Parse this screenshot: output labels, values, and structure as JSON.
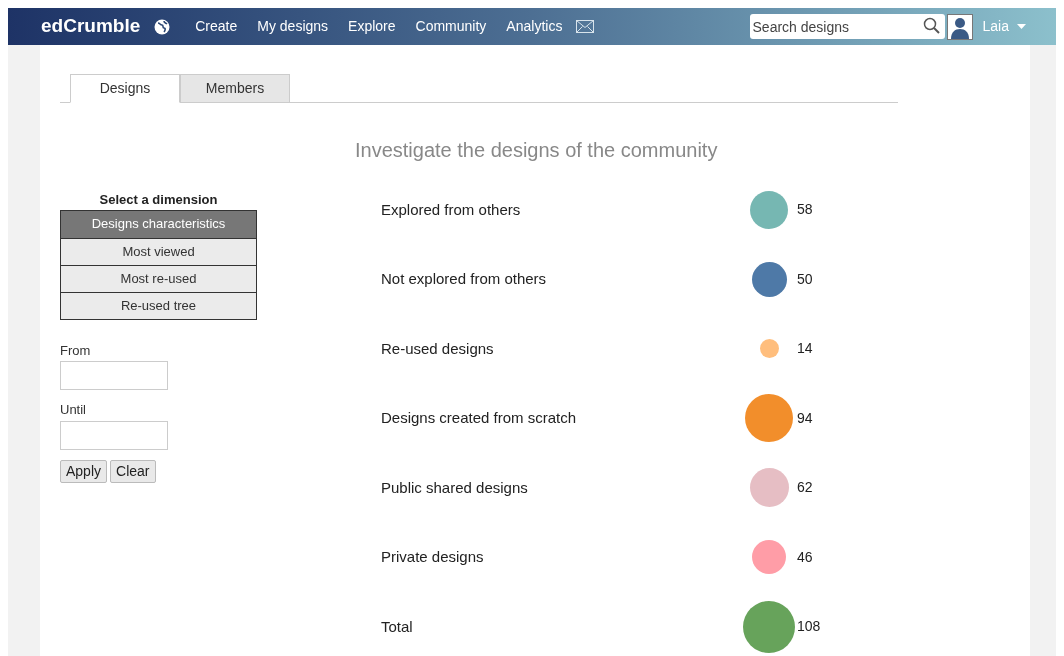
{
  "navbar": {
    "brand": "edCrumble",
    "links": [
      "Create",
      "My designs",
      "Explore",
      "Community",
      "Analytics"
    ],
    "search": {
      "placeholder": "Search designs"
    },
    "user": "Laia"
  },
  "tabs": [
    {
      "label": "Designs",
      "selected": true
    },
    {
      "label": "Members",
      "selected": false
    }
  ],
  "heading": "Investigate the designs of the community",
  "dimension": {
    "title": "Select a dimension",
    "items": [
      {
        "label": "Designs characteristics",
        "selected": true
      },
      {
        "label": "Most viewed",
        "selected": false
      },
      {
        "label": "Most re-used",
        "selected": false
      },
      {
        "label": "Re-used tree",
        "selected": false
      }
    ]
  },
  "filters": {
    "fields": [
      {
        "label": "From"
      },
      {
        "label": "Until"
      }
    ],
    "buttons": [
      "Apply",
      "Clear"
    ]
  },
  "stats": [
    {
      "label": "Explored from others",
      "value": "58",
      "color": "#76b7b2"
    },
    {
      "label": "Not explored from others",
      "value": "50",
      "color": "#4e79a7"
    },
    {
      "label": "Re-used designs",
      "value": "14",
      "color": "#ffbe7d"
    },
    {
      "label": "Designs created from scratch",
      "value": "94",
      "color": "#f28e2b"
    },
    {
      "label": "Public shared designs",
      "value": "62",
      "color": "#e6bec4"
    },
    {
      "label": "Private designs",
      "value": "46",
      "color": "#ff9da7"
    },
    {
      "label": "Total",
      "value": "108",
      "color": "#67a35b"
    }
  ]
}
